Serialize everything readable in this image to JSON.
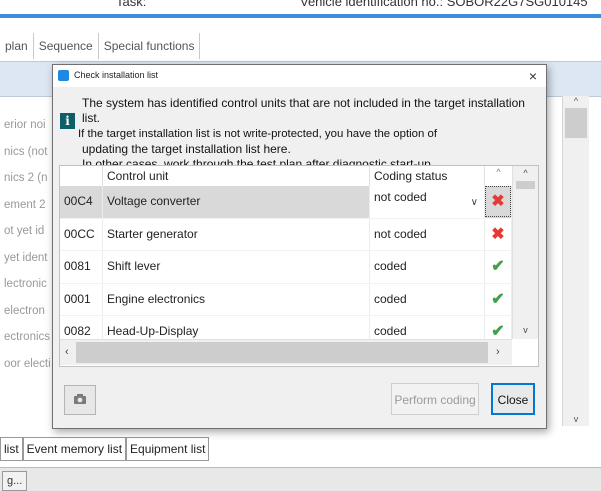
{
  "background": {
    "top_left_label": "Task:",
    "top_right_label": "Vehicle identification no.:  SOBOR22G7SG010145",
    "tabs": [
      "plan",
      "Sequence",
      "Special functions"
    ],
    "left_list": [
      "erior noi",
      "nics (not",
      "nics 2 (n",
      "ement 2",
      "ot yet id",
      "yet ident",
      "lectronic",
      "electron",
      "ectronics",
      "oor electi"
    ],
    "bottom_tabs": [
      "list",
      "Event memory list",
      "Equipment list"
    ],
    "status_button": "g..."
  },
  "dialog": {
    "title": "Check installation list",
    "close_glyph": "×",
    "info_glyph": "i",
    "message": {
      "line1": "The system has identified control units that are not included in the target installation list.",
      "line2": "If the target installation list is not write-protected, you have the option of",
      "line3": "updating the target installation list here.",
      "line4": "In other cases, work through the test plan after diagnostic start-up."
    },
    "table": {
      "headers": {
        "code": "",
        "unit": "Control unit",
        "status": "Coding status",
        "icon": "^"
      },
      "rows": [
        {
          "code": "00C4",
          "unit": "Voltage converter",
          "status": "not coded",
          "result": "error",
          "mark": "✖"
        },
        {
          "code": "00CC",
          "unit": "Starter generator",
          "status": "not coded",
          "result": "error",
          "mark": "✖"
        },
        {
          "code": "0081",
          "unit": "Shift lever",
          "status": "coded",
          "result": "ok",
          "mark": "✔"
        },
        {
          "code": "0001",
          "unit": "Engine electronics",
          "status": "coded",
          "result": "ok",
          "mark": "✔"
        },
        {
          "code": "0082",
          "unit": "Head-Up-Display",
          "status": "coded",
          "result": "ok",
          "mark": "✔"
        }
      ],
      "selected_row": 0,
      "dropdown_caret": "∨"
    },
    "buttons": {
      "camera_icon": "camera-icon",
      "perform": "Perform coding",
      "close": "Close"
    }
  },
  "colors": {
    "accent": "#0078d7",
    "error": "#e53935",
    "ok": "#43a047",
    "info_icon_bg": "#0e5e68"
  }
}
